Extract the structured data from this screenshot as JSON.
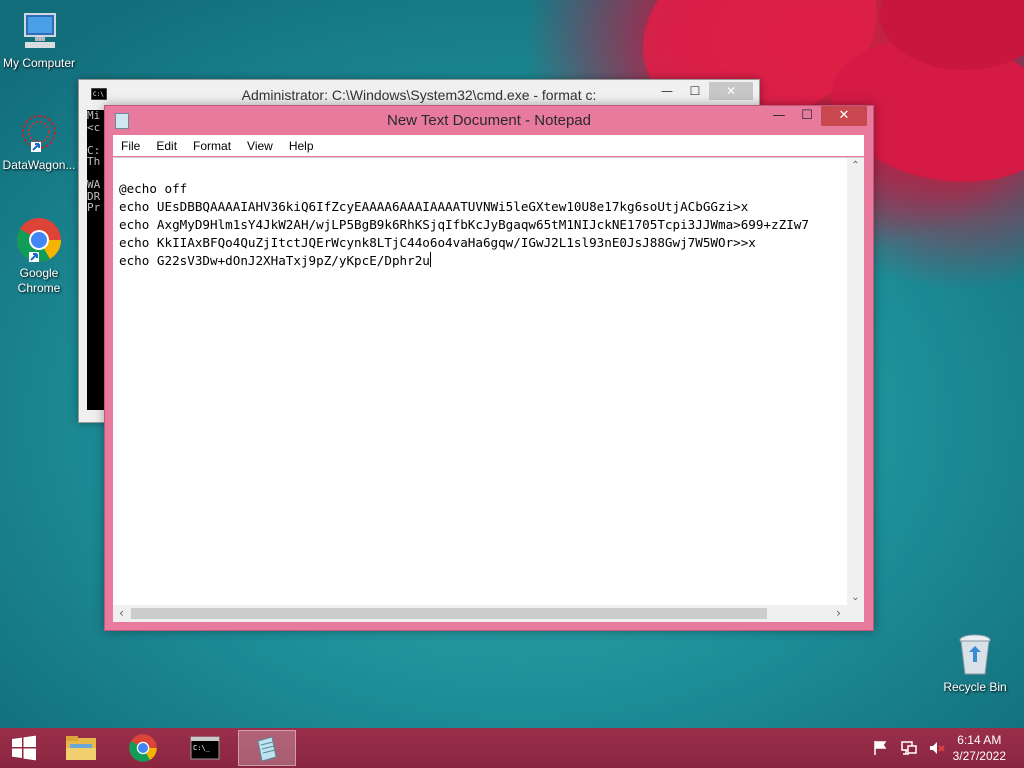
{
  "desktop": {
    "icons": [
      {
        "label": "My Computer"
      },
      {
        "label": "DataWagon..."
      },
      {
        "label": "Google Chrome"
      },
      {
        "label": "Recycle Bin"
      }
    ]
  },
  "cmd_window": {
    "title": "Administrator: C:\\Windows\\System32\\cmd.exe - format  c:",
    "visible_text": "Mi\n<c\n\nC:\nTh\n\nWA\nDR\nPr"
  },
  "notepad": {
    "title": "New Text Document - Notepad",
    "menu": [
      "File",
      "Edit",
      "Format",
      "View",
      "Help"
    ],
    "lines": [
      "@echo off",
      "",
      "echo UEsDBBQAAAAIAHV36kiQ6IfZcyEAAAA6AAAIAAAATUVNWi5leGXtew10U8e17kg6soUtjACbGGzi>x",
      "echo AxgMyD9Hlm1sY4JkW2AH/wjLP5BgB9k6RhKSjqIfbKcJyBgaqw65tM1NIJckNE1705Tcpi3JJWma>699+zZIw7",
      "echo KkIIAxBFQo4QuZjItctJQErWcynk8LTjC44o6o4vaHa6gqw/IGwJ2L1sl93nE0JsJ88Gwj7W5WOr>>x",
      "echo G22sV3Dw+dOnJ2XHaTxj9pZ/yKpcE/Dphr2u"
    ]
  },
  "window_controls": {
    "minimize": "—",
    "maximize": "☐",
    "close": "✕"
  },
  "taskbar": {
    "clock_time": "6:14 AM",
    "clock_date": "3/27/2022"
  }
}
